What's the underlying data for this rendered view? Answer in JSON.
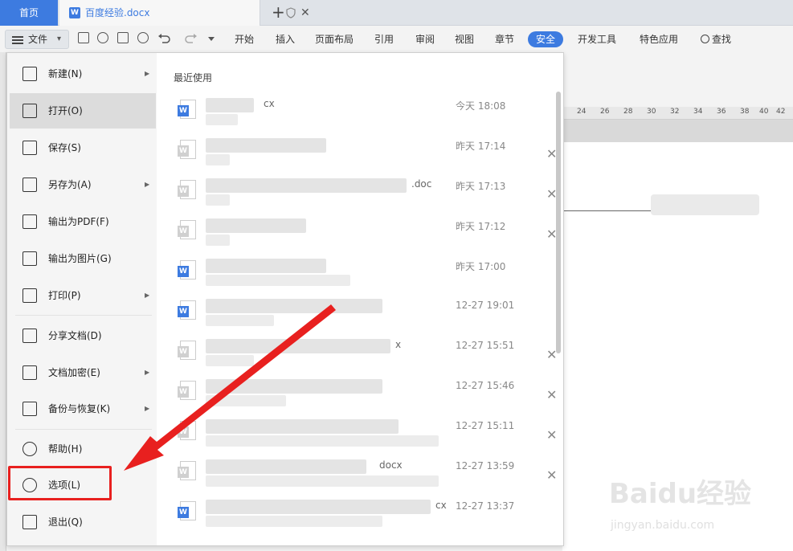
{
  "tabs": {
    "home": "首页",
    "doc_title": "百度经验.docx",
    "add": "+",
    "close": "✕"
  },
  "toolbar": {
    "file_label": "文件",
    "file_caret": "▾",
    "menus": [
      "开始",
      "插入",
      "页面布局",
      "引用",
      "审阅",
      "视图",
      "章节",
      "安全",
      "开发工具",
      "特色应用"
    ],
    "active_menu": "安全",
    "search_label": "查找"
  },
  "ruler": [
    "24",
    "26",
    "28",
    "30",
    "32",
    "34",
    "36",
    "38",
    "40",
    "42"
  ],
  "file_menu": {
    "items": [
      {
        "label": "新建(N)",
        "icon": "new-file-icon",
        "submenu": true
      },
      {
        "label": "打开(O)",
        "icon": "folder-open-icon",
        "submenu": false
      },
      {
        "label": "保存(S)",
        "icon": "save-icon",
        "submenu": false
      },
      {
        "label": "另存为(A)",
        "icon": "save-as-icon",
        "submenu": true
      },
      {
        "label": "输出为PDF(F)",
        "icon": "export-pdf-icon",
        "submenu": false
      },
      {
        "label": "输出为图片(G)",
        "icon": "export-image-icon",
        "submenu": false
      },
      {
        "label": "打印(P)",
        "icon": "printer-icon",
        "submenu": true
      },
      {
        "label": "分享文档(D)",
        "icon": "share-icon",
        "submenu": false
      },
      {
        "label": "文档加密(E)",
        "icon": "encrypt-icon",
        "submenu": true
      },
      {
        "label": "备份与恢复(K)",
        "icon": "backup-icon",
        "submenu": true
      },
      {
        "label": "帮助(H)",
        "icon": "help-icon",
        "submenu": false
      },
      {
        "label": "选项(L)",
        "icon": "gear-icon",
        "submenu": false
      },
      {
        "label": "退出(Q)",
        "icon": "exit-icon",
        "submenu": false
      }
    ],
    "submenu_arrow": "▶",
    "recent_title": "最近使用",
    "recent_files": [
      {
        "name_suffix": "cx",
        "time": "今天 18:08",
        "closable": false,
        "icon": "blue"
      },
      {
        "name_suffix": "",
        "time": "昨天 17:14",
        "closable": true,
        "icon": "gray"
      },
      {
        "name_suffix": ".doc",
        "time": "昨天 17:13",
        "closable": true,
        "icon": "gray"
      },
      {
        "name_suffix": "",
        "time": "昨天 17:12",
        "closable": true,
        "icon": "gray"
      },
      {
        "name_suffix": "",
        "time": "昨天 17:00",
        "closable": false,
        "icon": "blue"
      },
      {
        "name_suffix": "",
        "time": "12-27 19:01",
        "closable": false,
        "icon": "blue"
      },
      {
        "name_suffix": "x",
        "time": "12-27 15:51",
        "closable": true,
        "icon": "gray"
      },
      {
        "name_suffix": "",
        "time": "12-27 15:46",
        "closable": true,
        "icon": "gray"
      },
      {
        "name_suffix": "",
        "time": "12-27 15:11",
        "closable": true,
        "icon": "gray"
      },
      {
        "name_suffix": "docx",
        "time": "12-27 13:59",
        "closable": true,
        "icon": "gray"
      },
      {
        "name_suffix": "cx",
        "time": "12-27 13:37",
        "closable": false,
        "icon": "blue"
      }
    ]
  },
  "watermark": {
    "main": "Baidu经验",
    "sub": "jingyan.baidu.com"
  },
  "colors": {
    "accent": "#3d7be0",
    "annotation_red": "#e8201f"
  }
}
